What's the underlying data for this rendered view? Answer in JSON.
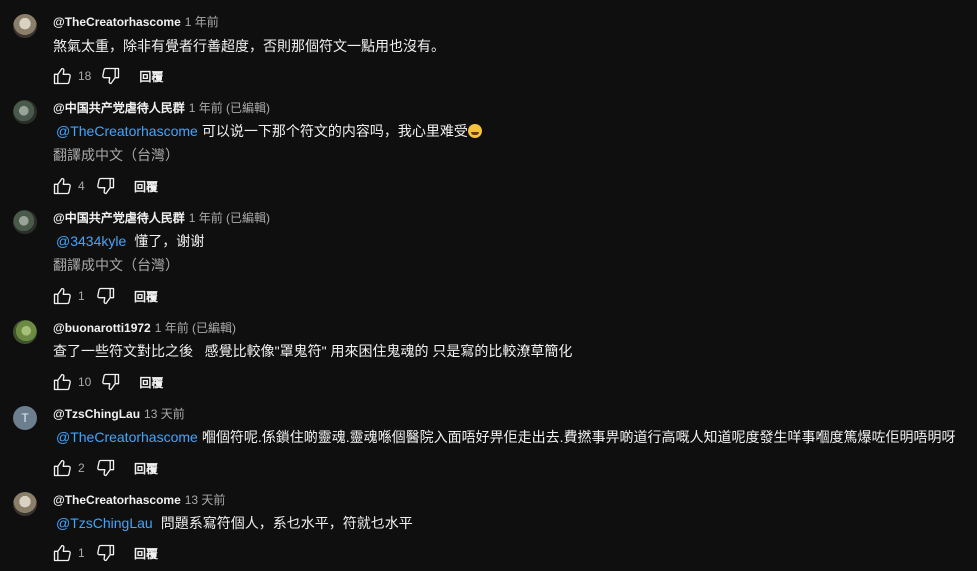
{
  "comments": [
    {
      "author": "@TheCreatorhascome",
      "meta": "1 年前",
      "mention": "",
      "text": "煞氣太重，除非有覺者行善超度，否則那個符文一點用也沒有。",
      "translate": "",
      "likes": "18",
      "reply_label": "回覆",
      "avatar_letter": ""
    },
    {
      "author": "@中国共产党虐待人民群",
      "meta": "1 年前 (已編輯)",
      "mention": "@TheCreatorhascome",
      "text": "可以说一下那个符文的内容吗，我心里难受",
      "emoji": "loudly-crying-face-emoji",
      "translate": "翻譯成中文（台灣）",
      "likes": "4",
      "reply_label": "回覆",
      "avatar_letter": ""
    },
    {
      "author": "@中国共产党虐待人民群",
      "meta": "1 年前 (已編輯)",
      "mention": "@3434kyle",
      "text": "懂了，谢谢",
      "translate": "翻譯成中文（台灣）",
      "likes": "1",
      "reply_label": "回覆",
      "avatar_letter": ""
    },
    {
      "author": "@buonarotti1972",
      "meta": "1 年前 (已編輯)",
      "mention": "",
      "text": "查了一些符文對比之後   感覺比較像\"罩鬼符\" 用來困住鬼魂的 只是寫的比較潦草簡化",
      "translate": "",
      "likes": "10",
      "reply_label": "回覆",
      "avatar_letter": ""
    },
    {
      "author": "@TzsChingLau",
      "meta": "13 天前",
      "mention": "@TheCreatorhascome",
      "text": "嗰個符呢.係鎖住啲靈魂.靈魂喺個醫院入面唔好畀佢走出去.費撚事畀啲道行高嘅人知道呢度發生咩事嗰度篤爆咗佢明唔明呀",
      "translate": "",
      "likes": "2",
      "reply_label": "回覆",
      "avatar_letter": "T"
    },
    {
      "author": "@TheCreatorhascome",
      "meta": "13 天前",
      "mention": "@TzsChingLau",
      "text": "問題系寫符個人，系乜水平，符就乜水平",
      "translate": "",
      "likes": "1",
      "reply_label": "回覆",
      "avatar_letter": ""
    }
  ]
}
